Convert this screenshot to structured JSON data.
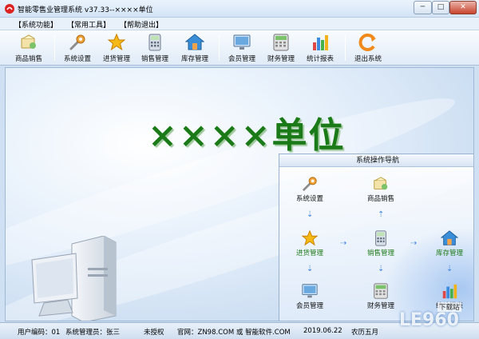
{
  "window": {
    "title": "智能零售业管理系统 v37.33--××××单位",
    "min_label": "─",
    "max_label": "□",
    "close_label": "✕"
  },
  "menu": [
    {
      "label": "【系统功能】"
    },
    {
      "label": "【常用工具】"
    },
    {
      "label": "【帮助退出】"
    }
  ],
  "toolbar": [
    {
      "label": "商品销售",
      "icon": "product-sale-icon"
    },
    {
      "label": "系统设置",
      "icon": "wrench-icon"
    },
    {
      "label": "进货管理",
      "icon": "star-icon"
    },
    {
      "label": "销售管理",
      "icon": "calculator-icon"
    },
    {
      "label": "库存管理",
      "icon": "house-icon"
    },
    {
      "label": "会员管理",
      "icon": "monitor-icon"
    },
    {
      "label": "财务管理",
      "icon": "cash-register-icon"
    },
    {
      "label": "统计报表",
      "icon": "bar-chart-icon"
    },
    {
      "label": "退出系统",
      "icon": "exit-icon"
    }
  ],
  "main": {
    "company_name": "××××单位"
  },
  "nav": {
    "title": "系统操作导航",
    "nodes": [
      {
        "label": "系统设置",
        "icon": "wrench-icon"
      },
      {
        "label": "商品销售",
        "icon": "product-sale-icon"
      },
      {
        "label": "进货管理",
        "icon": "star-icon"
      },
      {
        "label": "销售管理",
        "icon": "calculator-icon"
      },
      {
        "label": "库存管理",
        "icon": "house-icon"
      },
      {
        "label": "会员管理",
        "icon": "monitor-icon"
      },
      {
        "label": "财务管理",
        "icon": "cash-register-icon"
      },
      {
        "label": "统计报表",
        "icon": "bar-chart-icon"
      }
    ]
  },
  "status": {
    "user_code": "用户编码：01",
    "admin": "系统管理员：张三",
    "license": "未授权",
    "website": "官网：ZN98.COM 或 智能软件.COM",
    "date": "2019.06.22",
    "lunar": "农历五月"
  },
  "watermark": {
    "text": "LE960",
    "sub": "下载站"
  },
  "colors": {
    "company_green": "#1b7a18",
    "accent_blue": "#4a8be0"
  }
}
